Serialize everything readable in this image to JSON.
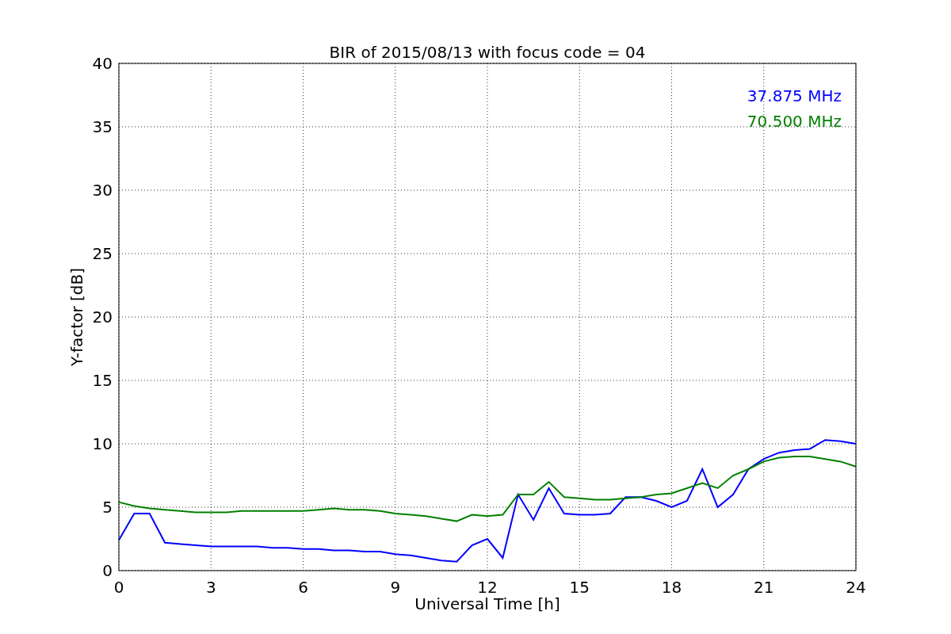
{
  "figure": {
    "chart_data": {
      "type": "line",
      "title": "BIR of 2015/08/13 with focus code = 04",
      "xlabel": "Universal Time [h]",
      "ylabel": "Y-factor [dB]",
      "x": [
        0,
        0.5,
        1,
        1.5,
        2,
        2.5,
        3,
        3.5,
        4,
        4.5,
        5,
        5.5,
        6,
        6.5,
        7,
        7.5,
        8,
        8.5,
        9,
        9.5,
        10,
        10.5,
        11,
        11.5,
        12,
        12.5,
        13,
        13.5,
        14,
        14.5,
        15,
        15.5,
        16,
        16.5,
        17,
        17.5,
        18,
        18.5,
        19,
        19.5,
        20,
        20.5,
        21,
        21.5,
        22,
        22.5,
        23,
        23.5,
        24
      ],
      "series": [
        {
          "name": "37.875 MHz",
          "color": "#0000ff",
          "values": [
            2.4,
            4.5,
            4.5,
            2.2,
            2.1,
            2.0,
            1.9,
            1.9,
            1.9,
            1.9,
            1.8,
            1.8,
            1.7,
            1.7,
            1.6,
            1.6,
            1.5,
            1.5,
            1.3,
            1.2,
            1.0,
            0.8,
            0.7,
            2.0,
            2.5,
            1.0,
            6.0,
            4.0,
            6.5,
            4.5,
            4.4,
            4.4,
            4.5,
            5.8,
            5.8,
            5.5,
            5.0,
            5.5,
            8.0,
            5.0,
            6.0,
            8.0,
            8.8,
            9.3,
            9.5,
            9.6,
            10.3,
            10.2,
            10.0
          ]
        },
        {
          "name": "70.500 MHz",
          "color": "#008000",
          "values": [
            5.4,
            5.1,
            4.9,
            4.8,
            4.7,
            4.6,
            4.6,
            4.6,
            4.7,
            4.7,
            4.7,
            4.7,
            4.7,
            4.8,
            4.9,
            4.8,
            4.8,
            4.7,
            4.5,
            4.4,
            4.3,
            4.1,
            3.9,
            4.4,
            4.3,
            4.4,
            6.0,
            6.0,
            7.0,
            5.8,
            5.7,
            5.6,
            5.6,
            5.7,
            5.8,
            6.0,
            6.1,
            6.5,
            6.9,
            6.5,
            7.5,
            8.0,
            8.6,
            8.9,
            9.0,
            9.0,
            8.8,
            8.6,
            8.2
          ]
        }
      ],
      "grid": true,
      "xlim": [
        0,
        24
      ],
      "ylim": [
        0,
        40
      ],
      "xticks": [
        0,
        3,
        6,
        9,
        12,
        15,
        18,
        21,
        24
      ],
      "yticks": [
        0,
        5,
        10,
        15,
        20,
        25,
        30,
        35,
        40
      ]
    }
  }
}
